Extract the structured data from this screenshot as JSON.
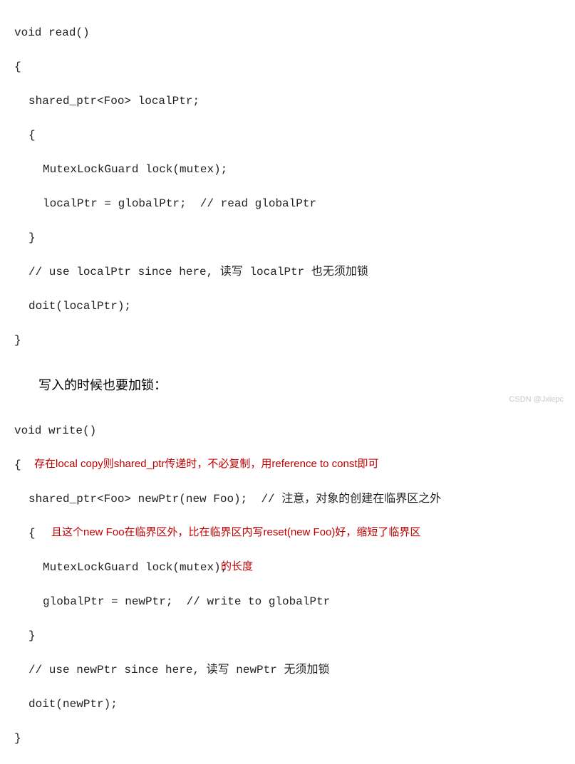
{
  "read": {
    "l1": "void read()",
    "l2": "{",
    "l3": "shared_ptr<Foo> localPtr;",
    "l4": "{",
    "l5": "MutexLockGuard lock(mutex);",
    "l6": "localPtr = globalPtr;  // read globalPtr",
    "l7": "}",
    "l8": "// use localPtr since here, 读写 localPtr 也无须加锁",
    "l9": "doit(localPtr);",
    "l10": "}"
  },
  "prose1": "写入的时候也要加锁：",
  "write": {
    "l1": "void write()",
    "l2": "{",
    "l3": "shared_ptr<Foo> newPtr(new Foo);  // 注意，对象的创建在临界区之外",
    "l4": "{",
    "l5a": "MutexLockGuard lock(mutex);",
    "l6": "globalPtr = newPtr;  // write to globalPtr",
    "l7": "}",
    "l8": "// use newPtr since here, 读写 newPtr 无须加锁",
    "l9": "doit(newPtr);",
    "l10": "}"
  },
  "annotations": {
    "a1": "存在local copy则shared_ptr传递时，不必复制，用reference to const即可",
    "a2": "且这个new Foo在临界区外，比在临界区内写reset(new Foo)好，缩短了临界区",
    "a3": "的长度"
  },
  "watermark": "CSDN @Jxiepc"
}
